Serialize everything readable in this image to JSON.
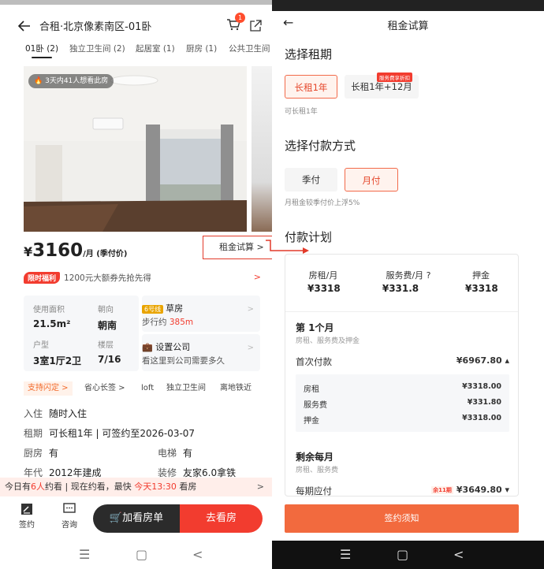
{
  "left": {
    "title": "合租·北京像素南区-01卧",
    "cart_badge": "1",
    "room_tabs": [
      "01卧 (2)",
      "独立卫生间 (2)",
      "起居室 (1)",
      "厨房 (1)",
      "公共卫生间"
    ],
    "views_text": "3天内41人想看此房",
    "price": {
      "yen": "¥",
      "number": "3160",
      "unit": "/月 (季付价)"
    },
    "calc_link": "租金试算 >",
    "promo": {
      "tag": "限时福利",
      "text": "1200元大额券先抢先得",
      "arrow": ">"
    },
    "info": [
      {
        "label": "使用面积",
        "value": "21.5m²"
      },
      {
        "label": "朝向",
        "value": "朝南"
      },
      {
        "label": "户型",
        "value": "3室1厅2卫"
      },
      {
        "label": "楼层",
        "value": "7/16"
      }
    ],
    "subway": {
      "line": "6号线",
      "station": "草房",
      "walk_prefix": "步行约",
      "walk_value": "385m"
    },
    "company": {
      "title": "设置公司",
      "subtitle": "看这里到公司需要多久"
    },
    "tags": [
      "支持闪定 >",
      "省心长签 >",
      "loft",
      "独立卫生间",
      "离地铁近"
    ],
    "details": [
      {
        "label": "入住",
        "value": "随时入住"
      },
      {
        "label": "租期",
        "value": "可长租1年 | 可签约至2026-03-07"
      },
      {
        "label": "厨房",
        "value": "有",
        "label2": "电梯",
        "value2": "有"
      },
      {
        "label": "年代",
        "value": "2012年建成",
        "label2": "装修",
        "value2": "友家6.0拿铁"
      }
    ],
    "notice": {
      "prefix": "今日有",
      "count": "6人",
      "middle": "约看 | 现在约看，最快",
      "time": "今天13:30",
      "suffix": "看房",
      "arrow": ">"
    },
    "bottom": {
      "sign": "签约",
      "consult": "咨询",
      "add_list": "加看房单",
      "go_see": "去看房"
    },
    "nav": [
      "☰",
      "▢",
      "<"
    ]
  },
  "right": {
    "title": "租金试算",
    "back": "←",
    "lease_heading": "选择租期",
    "lease_options": [
      "长租1年",
      "长租1年+12月"
    ],
    "lease_badge": "服务费享折扣",
    "lease_hint": "可长租1年",
    "pay_heading": "选择付款方式",
    "pay_options": [
      "季付",
      "月付"
    ],
    "pay_hint": "月租金较季付价上浮5%",
    "plan_heading": "付款计划",
    "plan": {
      "columns": [
        {
          "head": "房租/月",
          "value": "¥3318"
        },
        {
          "head": "服务费/月 ?",
          "value": "¥331.8"
        },
        {
          "head": "押金",
          "value": "¥3318"
        }
      ],
      "first_month": {
        "title": "第 1个月",
        "subtitle": "房租、服务费及押金",
        "label": "首次付款",
        "amount": "¥6967.80 ▴",
        "items": [
          {
            "label": "房租",
            "amount": "¥3318.00"
          },
          {
            "label": "服务费",
            "amount": "¥331.80"
          },
          {
            "label": "押金",
            "amount": "¥3318.00"
          }
        ]
      },
      "remaining": {
        "title": "剩余每月",
        "subtitle": "房租、服务费",
        "label": "每期应付",
        "badge": "余11期",
        "amount": "¥3649.80 ▾"
      }
    },
    "sign_button": "签约须知",
    "nav": [
      "☰",
      "▢",
      "<"
    ]
  },
  "colors": {
    "accent": "#f23c2f",
    "button_orange": "#f26a3e",
    "dark_button": "#2b2b2b"
  }
}
